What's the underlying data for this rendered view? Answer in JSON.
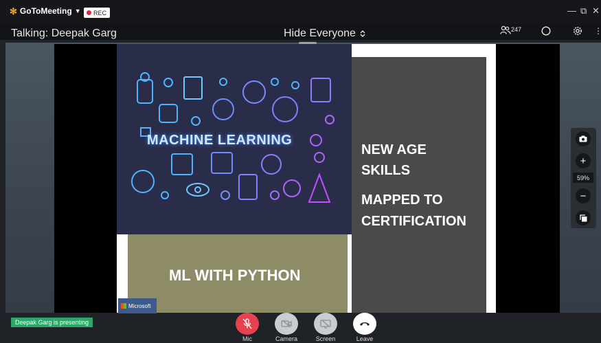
{
  "app": {
    "name": "GoToMeeting",
    "rec_label": "REC"
  },
  "window": {
    "minimize": "—",
    "restore": "⧉",
    "close": "✕"
  },
  "info": {
    "talking": "Talking: Deepak Garg",
    "hide_everyone": "Hide Everyone",
    "attendees_count": "247"
  },
  "slide": {
    "left_title": "MACHINE LEARNING",
    "bottom_title": "ML WITH PYTHON",
    "right_line1": "NEW AGE",
    "right_line2": "SKILLS",
    "right_line3": "MAPPED TO",
    "right_line4": "CERTIFICATION",
    "badge": "Microsoft"
  },
  "zoom": {
    "level": "59%",
    "plus": "+",
    "minus": "−"
  },
  "status": {
    "presenting": "Deepak Garg is presenting"
  },
  "controls": [
    {
      "label": "Mic"
    },
    {
      "label": "Camera"
    },
    {
      "label": "Screen"
    },
    {
      "label": "Leave"
    }
  ],
  "colors": {
    "accent_orange": "#f7a21c",
    "rec_red": "#e5243b",
    "mic_red": "#e5414f",
    "presenting_green": "#2ea86a"
  }
}
